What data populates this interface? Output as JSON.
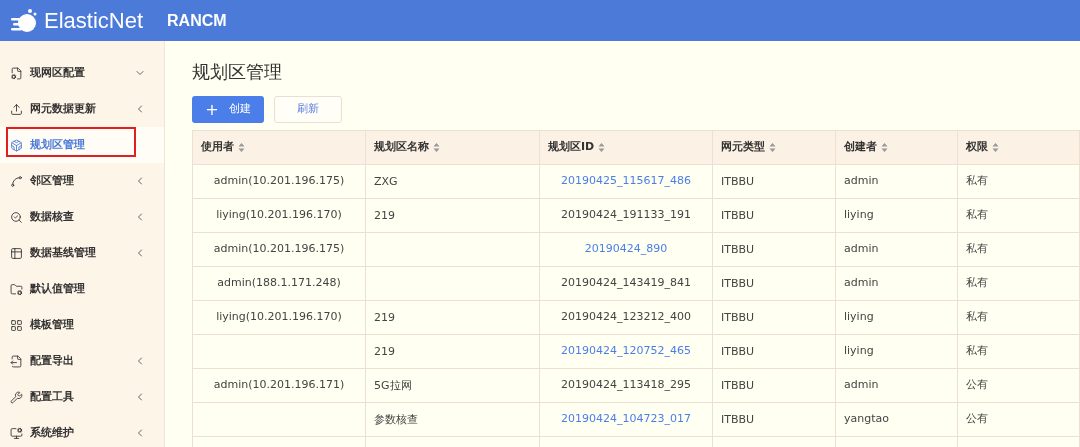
{
  "header": {
    "logo_text": "ElasticNet",
    "product": "RANCM"
  },
  "sidebar": {
    "items": [
      {
        "label": "现网区配置",
        "selected": false,
        "expandable": true,
        "expanded": true
      },
      {
        "label": "网元数据更新",
        "selected": false,
        "expandable": true,
        "expanded": false
      },
      {
        "label": "规划区管理",
        "selected": true,
        "expandable": false
      },
      {
        "label": "邻区管理",
        "selected": false,
        "expandable": true,
        "expanded": false
      },
      {
        "label": "数据核查",
        "selected": false,
        "expandable": true,
        "expanded": false
      },
      {
        "label": "数据基线管理",
        "selected": false,
        "expandable": true,
        "expanded": false
      },
      {
        "label": "默认值管理",
        "selected": false,
        "expandable": false
      },
      {
        "label": "模板管理",
        "selected": false,
        "expandable": false
      },
      {
        "label": "配置导出",
        "selected": false,
        "expandable": true,
        "expanded": false
      },
      {
        "label": "配置工具",
        "selected": false,
        "expandable": true,
        "expanded": false
      },
      {
        "label": "系统维护",
        "selected": false,
        "expandable": true,
        "expanded": false
      }
    ]
  },
  "page_title": "规划区管理",
  "buttons": {
    "create": {
      "icon": "+",
      "label": "创建"
    },
    "refresh": {
      "label": "刷新"
    }
  },
  "table": {
    "columns": [
      "使用者",
      "规划区名称",
      "规划区ID",
      "网元类型",
      "创建者",
      "权限"
    ],
    "rows": [
      {
        "user": "admin(10.201.196.175)",
        "name": "ZXG",
        "id": "20190425_115617_486",
        "id_link": true,
        "type": "ITBBU",
        "creator": "admin",
        "permission": "私有"
      },
      {
        "user": "liying(10.201.196.170)",
        "name": "219",
        "id": "20190424_191133_191",
        "id_link": false,
        "type": "ITBBU",
        "creator": "liying",
        "permission": "私有"
      },
      {
        "user": "admin(10.201.196.175)",
        "name": "",
        "id": "20190424_890",
        "id_link": true,
        "type": "ITBBU",
        "creator": "admin",
        "permission": "私有"
      },
      {
        "user": "admin(188.1.171.248)",
        "name": "",
        "id": "20190424_143419_841",
        "id_link": false,
        "type": "ITBBU",
        "creator": "admin",
        "permission": "私有"
      },
      {
        "user": "liying(10.201.196.170)",
        "name": "219",
        "id": "20190424_123212_400",
        "id_link": false,
        "type": "ITBBU",
        "creator": "liying",
        "permission": "私有"
      },
      {
        "user": "",
        "name": "219",
        "id": "20190424_120752_465",
        "id_link": true,
        "type": "ITBBU",
        "creator": "liying",
        "permission": "私有"
      },
      {
        "user": "admin(10.201.196.171)",
        "name": "5G拉网",
        "id": "20190424_113418_295",
        "id_link": false,
        "type": "ITBBU",
        "creator": "admin",
        "permission": "公有"
      },
      {
        "user": "",
        "name": "参数核查",
        "id": "20190424_104723_017",
        "id_link": true,
        "type": "ITBBU",
        "creator": "yangtao",
        "permission": "公有"
      }
    ]
  }
}
